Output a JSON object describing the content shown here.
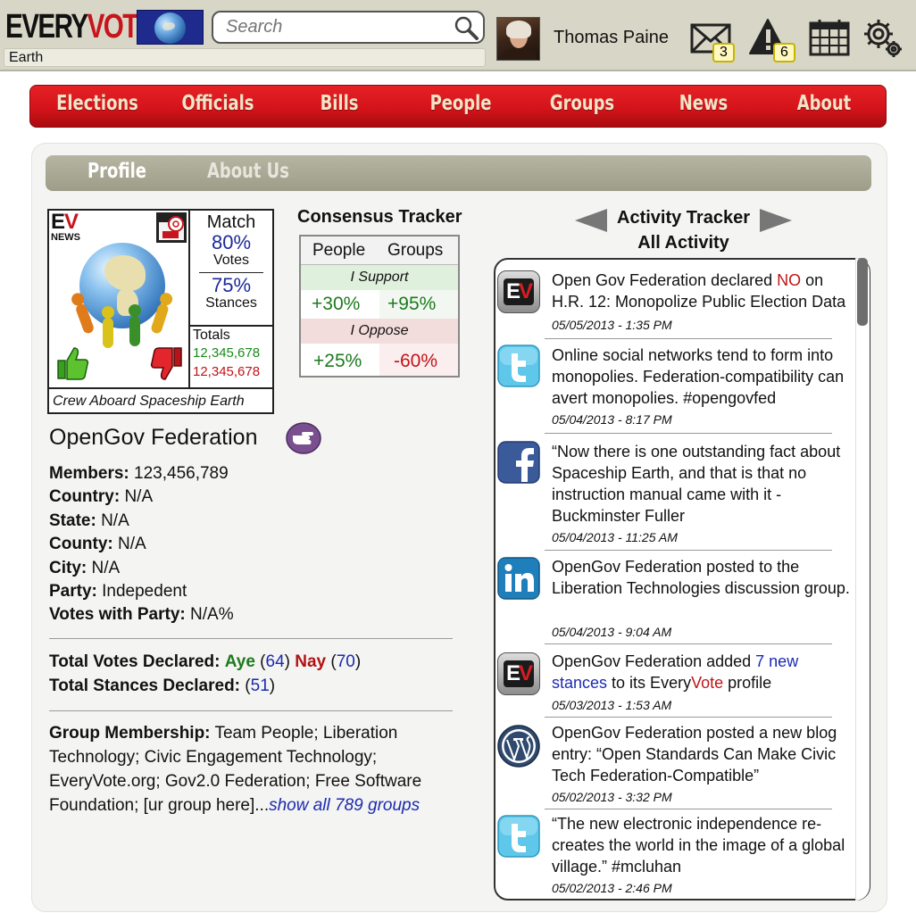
{
  "header": {
    "logo_every": "EVERY",
    "logo_vote": "VOTE",
    "location": "Earth",
    "search_placeholder": "Search",
    "username": "Thomas Paine",
    "messages_count": "3",
    "alerts_count": "6"
  },
  "nav": {
    "items": [
      "Elections",
      "Officials",
      "Bills",
      "People",
      "Groups",
      "News",
      "About"
    ]
  },
  "subtabs": {
    "profile": "Profile",
    "about": "About Us"
  },
  "card": {
    "ev": "EV",
    "news": "NEWS",
    "match_title": "Match",
    "votes_pct": "80%",
    "votes_label": "Votes",
    "stances_pct": "75%",
    "stances_label": "Stances",
    "totals_label": "Totals",
    "totals_support": "12,345,678",
    "totals_oppose": "12,345,678",
    "caption": "Crew Aboard Spaceship Earth"
  },
  "consensus": {
    "title": "Consensus Tracker",
    "col_people": "People",
    "col_groups": "Groups",
    "support_label": "I Support",
    "support_people": "+30%",
    "support_groups": "+95%",
    "oppose_label": "I Oppose",
    "oppose_people": "+25%",
    "oppose_groups": "-60%"
  },
  "org": {
    "name": "OpenGov Federation",
    "members_label": "Members:",
    "members_value": "123,456,789",
    "country_label": "Country:",
    "country_value": "N/A",
    "state_label": "State:",
    "state_value": "N/A",
    "county_label": "County:",
    "county_value": "N/A",
    "city_label": "City:",
    "city_value": "N/A",
    "party_label": "Party:",
    "party_value": "Indepedent",
    "votes_with_party_label": "Votes with Party:",
    "votes_with_party_value": "N/A%",
    "total_votes_label": "Total Votes Declared:",
    "aye_label": "Aye",
    "aye_count": "64",
    "nay_label": "Nay",
    "nay_count": "70",
    "total_stances_label": "Total Stances Declared:",
    "stances_count": "51",
    "membership_label": "Group Membership:",
    "membership_text": "Team People; Liberation Technology; Civic Engagement Technology; EveryVote.org; Gov2.0 Federation; Free Software Foundation; [ur group here]...",
    "membership_link": "show all 789 groups"
  },
  "activity": {
    "title": "Activity Tracker",
    "filter": "All Activity",
    "items": [
      {
        "source": "everyvote",
        "text_a": "Open Gov Federation declared ",
        "text_em": "NO",
        "text_b": " on H.R. 12: Monopolize Public Election Data",
        "date": "05/05/2013 - 1:35 PM"
      },
      {
        "source": "twitter",
        "text": "Online social networks tend to form into monopolies. Federation-compatibility can avert monopolies. #opengovfed",
        "date": "05/04/2013 - 8:17 PM"
      },
      {
        "source": "facebook",
        "text": "“Now there is one outstanding fact about Spaceship Earth, and that is that no instruction manual came with it - Buckminster Fuller",
        "date": "05/04/2013 - 11:25 AM"
      },
      {
        "source": "linkedin",
        "text": "OpenGov Federation posted to the Liberation Technologies discussion group.",
        "date": "05/04/2013 - 9:04 AM"
      },
      {
        "source": "everyvote",
        "text_a": "OpenGov Federation added ",
        "text_link": "7 new stances",
        "text_b": " to its Every",
        "text_vote": "Vote",
        "text_c": " profile",
        "date": "05/03/2013 - 1:53 AM"
      },
      {
        "source": "wordpress",
        "text": "OpenGov Federation posted a new blog entry: “Open Standards Can Make Civic Tech Federation-Compatible”",
        "date": "05/02/2013 - 3:32 PM"
      },
      {
        "source": "twitter",
        "text": "“The new electronic independence re-creates the world in the image of a global village.” #mcluhan",
        "date": "05/02/2013 - 2:46 PM"
      }
    ]
  }
}
